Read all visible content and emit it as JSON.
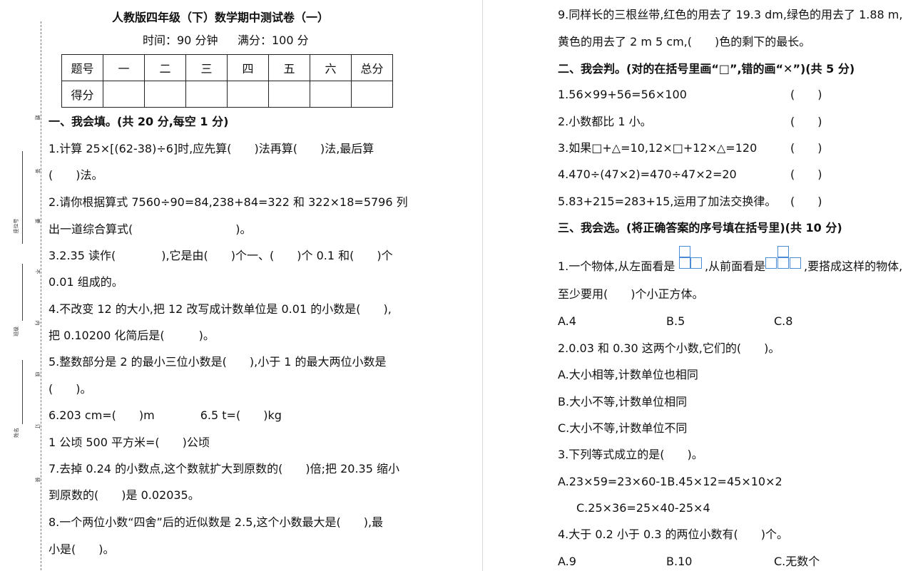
{
  "header": {
    "title": "人教版四年级（下）数学期中测试卷（一）",
    "time": "时间：90 分钟",
    "score": "满分：100 分"
  },
  "score_table": {
    "row1": [
      "题号",
      "一",
      "二",
      "三",
      "四",
      "五",
      "六",
      "总分"
    ],
    "row2": [
      "得分",
      "",
      "",
      "",
      "",
      "",
      "",
      ""
    ]
  },
  "margin": {
    "chars": [
      "题",
      "答",
      "要",
      "不",
      "内",
      "线",
      "订",
      "装"
    ],
    "labels": [
      "座位号",
      "班级",
      "姓名"
    ]
  },
  "left": {
    "section1": "一、我会填。(共 20 分,每空 1 分)",
    "lines": [
      "1.计算 25×[(62-38)÷6]时,应先算(　　)法再算(　　)法,最后算",
      "(　　)法。",
      "2.请你根据算式 7560÷90=84,238+84=322 和 322×18=5796 列",
      "出一道综合算式(　　　　　　　　　)。",
      "3.2.35 读作(　　　　),它是由(　　)个一、(　　)个 0.1 和(　　)个",
      "0.01 组成的。",
      "4.不改变 12 的大小,把 12 改写成计数单位是 0.01 的小数是(　　),",
      "把 0.10200 化简后是(　　　)。",
      "5.整数部分是 2 的最小三位小数是(　　),小于 1 的最大两位小数是",
      "(　　)。",
      "6.203 cm=(　　)m　　　　6.5 t=(　　)kg",
      "1 公顷 500 平方米=(　　)公顷",
      "7.去掉 0.24 的小数点,这个数就扩大到原数的(　　)倍;把 20.35 缩小",
      "到原数的(　　)是 0.02035。",
      "8.一个两位小数“四舍”后的近似数是 2.5,这个小数最大是(　　),最",
      "小是(　　)。"
    ]
  },
  "right": {
    "q9_line1": "9.同样长的三根丝带,红色的用去了 19.3 dm,绿色的用去了 1.88 m,",
    "q9_line2": "黄色的用去了 2 m 5 cm,(　　)色的剩下的最长。",
    "section2": "二、我会判。(对的在括号里画“□”,错的画“✕”)(共 5 分)",
    "judge": [
      {
        "text": "1.56×99+56=56×100",
        "paren": "(　　)"
      },
      {
        "text": "2.小数都比 1 小。",
        "paren": "(　　)"
      },
      {
        "text": "3.如果□+△=10,12×□+12×△=120",
        "paren": "(　　)"
      },
      {
        "text": "4.470÷(47×2)=470÷47×2=20",
        "paren": "(　　)"
      },
      {
        "text": "5.83+215=283+15,运用了加法交换律。",
        "paren": "(　　)"
      }
    ],
    "section3": "三、我会选。(将正确答案的序号填在括号里)(共 10 分)",
    "q1_a": "1.一个物体,从左面看是",
    "q1_b": ",从前面看是",
    "q1_c": ",要搭成这样的物体,",
    "q1_line2": "至少要用(　　)个小正方体。",
    "q1_opts": [
      "A.4",
      "B.5",
      "C.8"
    ],
    "q2": "2.0.03 和 0.30 这两个小数,它们的(　　)。",
    "q2_opts": [
      "A.大小相等,计数单位也相同",
      "B.大小不等,计数单位相同",
      "C.大小不等,计数单位不同"
    ],
    "q3": "3.下列等式成立的是(　　)。",
    "q3_ab": "A.23×59=23×60-1B.45×12=45×10×2",
    "q3_c": "C.25×36=25×40-25×4",
    "q4": "4.大于 0.2 小于 0.3 的两位小数有(　　)个。",
    "q4_opts": [
      "A.9",
      "B.10",
      "C.无数个"
    ]
  }
}
